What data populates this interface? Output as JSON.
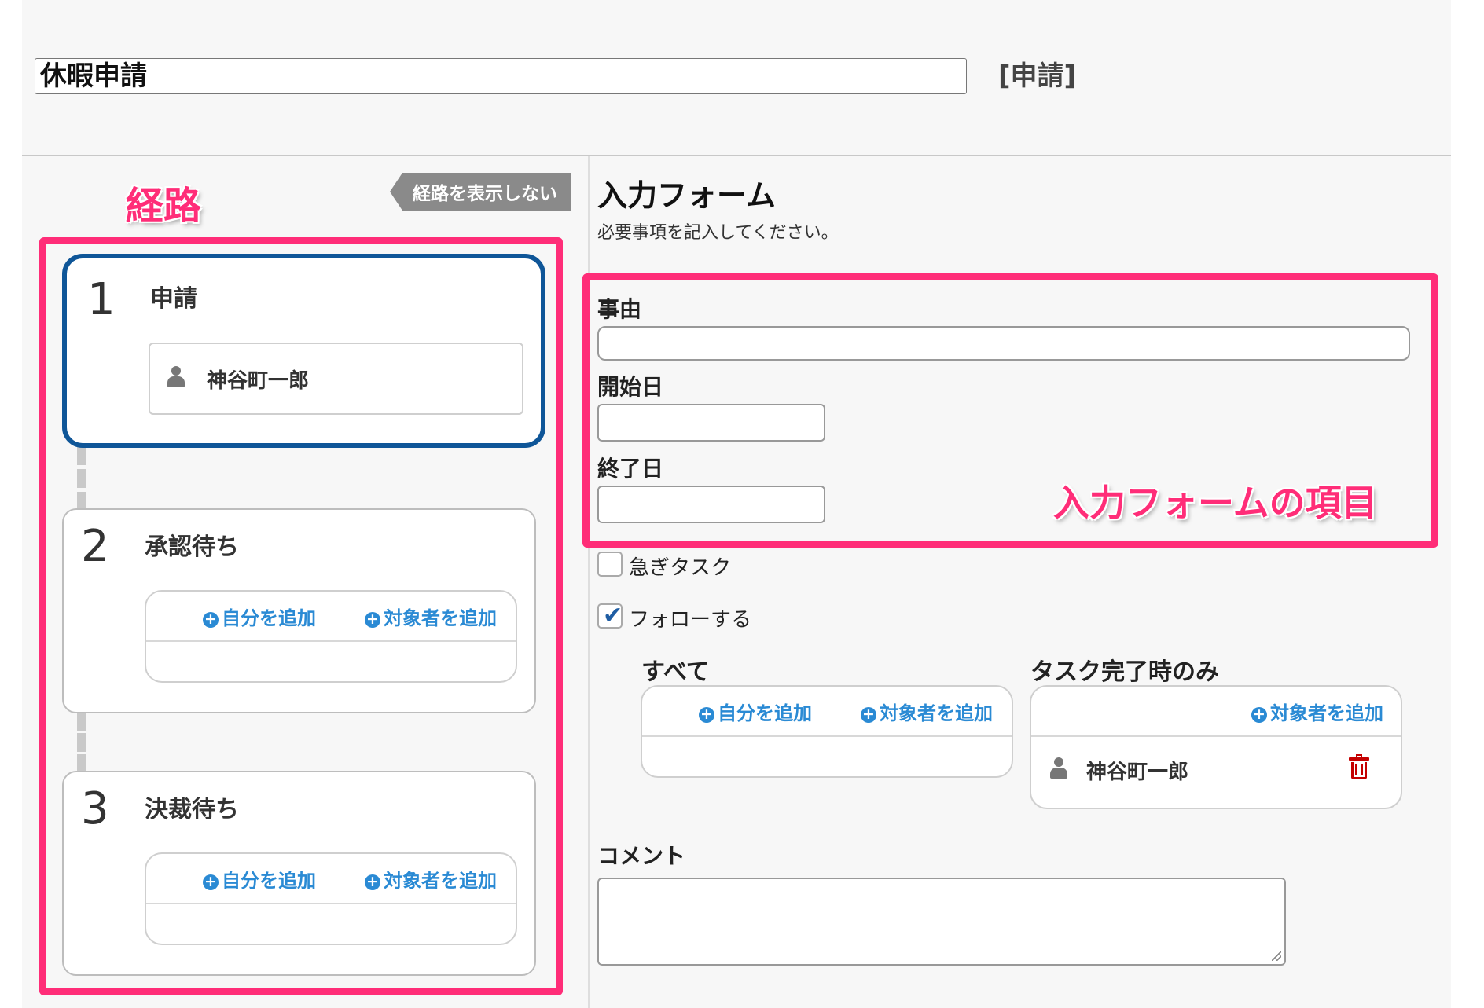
{
  "header": {
    "title_value": "休暇申請",
    "tag": "[申請]"
  },
  "annotations": {
    "route": "経路",
    "form_items": "入力フォームの項目",
    "highlight_color": "#ff2d78"
  },
  "route": {
    "hide_button": "経路を表示しない",
    "steps": [
      {
        "number": "1",
        "label": "申請",
        "assignee": "神谷町一郎",
        "active": true
      },
      {
        "number": "2",
        "label": "承認待ち",
        "add_self": "自分を追加",
        "add_target": "対象者を追加"
      },
      {
        "number": "3",
        "label": "決裁待ち",
        "add_self": "自分を追加",
        "add_target": "対象者を追加"
      }
    ],
    "active_color": "#0f5698"
  },
  "form": {
    "title": "入力フォーム",
    "subtitle": "必要事項を記入してください。",
    "fields": {
      "reason": {
        "label": "事由",
        "value": ""
      },
      "start_date": {
        "label": "開始日",
        "value": ""
      },
      "end_date": {
        "label": "終了日",
        "value": ""
      }
    },
    "urgent": {
      "label": "急ぎタスク",
      "checked": false
    },
    "follow": {
      "label": "フォローする",
      "checked": true
    },
    "follow_all": {
      "heading": "すべて",
      "add_self": "自分を追加",
      "add_target": "対象者を追加"
    },
    "follow_on_complete": {
      "heading": "タスク完了時のみ",
      "add_target": "対象者を追加",
      "assignee": "神谷町一郎"
    },
    "comment": {
      "label": "コメント",
      "value": ""
    }
  },
  "colors": {
    "link": "#2a8ad4",
    "delete": "#c40000"
  },
  "icons": {
    "plus": "plus-circle-icon",
    "person": "person-icon",
    "trash": "trash-icon",
    "check": "check-icon"
  }
}
